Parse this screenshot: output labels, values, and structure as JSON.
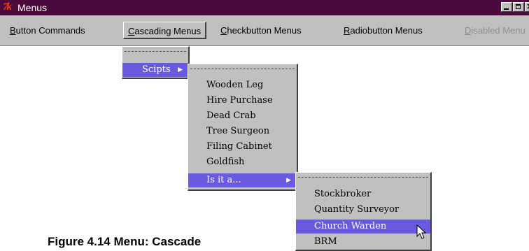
{
  "window": {
    "title": "Menus",
    "icon": "tk-icon",
    "icon_glyph": "7k"
  },
  "menubar": {
    "items": [
      {
        "prefix": "",
        "accel": "B",
        "rest": "utton Commands",
        "state": "normal"
      },
      {
        "prefix": "",
        "accel": "C",
        "rest": "ascading Menus",
        "state": "active"
      },
      {
        "prefix": "",
        "accel": "C",
        "rest": "heckbutton Menus",
        "state": "normal"
      },
      {
        "prefix": "",
        "accel": "R",
        "rest": "adiobutton Menus",
        "state": "normal"
      },
      {
        "prefix": "",
        "accel": "D",
        "rest": "isabled Menu",
        "state": "disabled"
      }
    ]
  },
  "cascade_menu": {
    "items": [
      {
        "label": "Scipts",
        "submenu": true,
        "selected": true
      }
    ]
  },
  "scripts_menu": {
    "items": [
      {
        "label": "Wooden Leg"
      },
      {
        "label": "Hire Purchase"
      },
      {
        "label": "Dead Crab"
      },
      {
        "label": "Tree Surgeon"
      },
      {
        "label": "Filing Cabinet"
      },
      {
        "label": "Goldfish"
      },
      {
        "label": "Is it a...",
        "submenu": true,
        "selected": true
      }
    ]
  },
  "isita_menu": {
    "items": [
      {
        "label": "Stockbroker"
      },
      {
        "label": "Quantity Surveyor"
      },
      {
        "label": "Church Warden",
        "selected": true
      },
      {
        "label": "BRM"
      }
    ]
  },
  "caption": "Figure 4.14  Menu: Cascade",
  "colors": {
    "titlebar": "#4b0a3c",
    "menu_bg": "#c0c0c0",
    "selection": "#6a5ae0"
  }
}
